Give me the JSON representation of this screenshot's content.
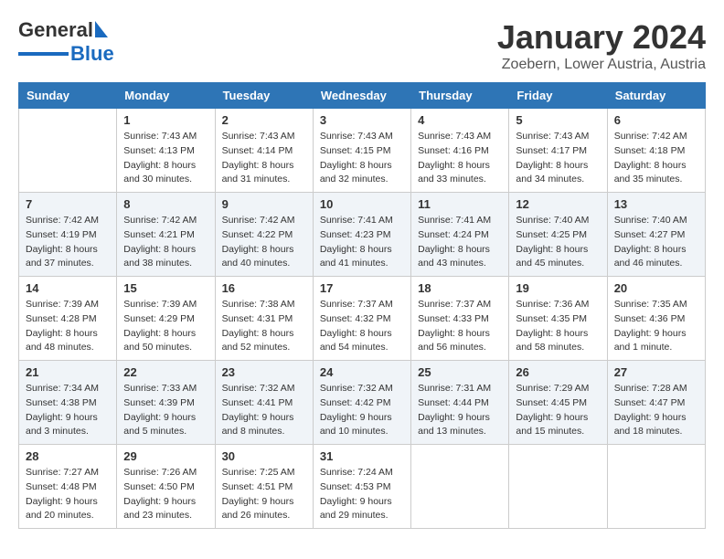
{
  "header": {
    "logo_general": "General",
    "logo_blue": "Blue",
    "month_title": "January 2024",
    "location": "Zoebern, Lower Austria, Austria"
  },
  "columns": [
    "Sunday",
    "Monday",
    "Tuesday",
    "Wednesday",
    "Thursday",
    "Friday",
    "Saturday"
  ],
  "weeks": [
    [
      {
        "day": "",
        "sunrise": "",
        "sunset": "",
        "daylight": ""
      },
      {
        "day": "1",
        "sunrise": "Sunrise: 7:43 AM",
        "sunset": "Sunset: 4:13 PM",
        "daylight": "Daylight: 8 hours and 30 minutes."
      },
      {
        "day": "2",
        "sunrise": "Sunrise: 7:43 AM",
        "sunset": "Sunset: 4:14 PM",
        "daylight": "Daylight: 8 hours and 31 minutes."
      },
      {
        "day": "3",
        "sunrise": "Sunrise: 7:43 AM",
        "sunset": "Sunset: 4:15 PM",
        "daylight": "Daylight: 8 hours and 32 minutes."
      },
      {
        "day": "4",
        "sunrise": "Sunrise: 7:43 AM",
        "sunset": "Sunset: 4:16 PM",
        "daylight": "Daylight: 8 hours and 33 minutes."
      },
      {
        "day": "5",
        "sunrise": "Sunrise: 7:43 AM",
        "sunset": "Sunset: 4:17 PM",
        "daylight": "Daylight: 8 hours and 34 minutes."
      },
      {
        "day": "6",
        "sunrise": "Sunrise: 7:42 AM",
        "sunset": "Sunset: 4:18 PM",
        "daylight": "Daylight: 8 hours and 35 minutes."
      }
    ],
    [
      {
        "day": "7",
        "sunrise": "Sunrise: 7:42 AM",
        "sunset": "Sunset: 4:19 PM",
        "daylight": "Daylight: 8 hours and 37 minutes."
      },
      {
        "day": "8",
        "sunrise": "Sunrise: 7:42 AM",
        "sunset": "Sunset: 4:21 PM",
        "daylight": "Daylight: 8 hours and 38 minutes."
      },
      {
        "day": "9",
        "sunrise": "Sunrise: 7:42 AM",
        "sunset": "Sunset: 4:22 PM",
        "daylight": "Daylight: 8 hours and 40 minutes."
      },
      {
        "day": "10",
        "sunrise": "Sunrise: 7:41 AM",
        "sunset": "Sunset: 4:23 PM",
        "daylight": "Daylight: 8 hours and 41 minutes."
      },
      {
        "day": "11",
        "sunrise": "Sunrise: 7:41 AM",
        "sunset": "Sunset: 4:24 PM",
        "daylight": "Daylight: 8 hours and 43 minutes."
      },
      {
        "day": "12",
        "sunrise": "Sunrise: 7:40 AM",
        "sunset": "Sunset: 4:25 PM",
        "daylight": "Daylight: 8 hours and 45 minutes."
      },
      {
        "day": "13",
        "sunrise": "Sunrise: 7:40 AM",
        "sunset": "Sunset: 4:27 PM",
        "daylight": "Daylight: 8 hours and 46 minutes."
      }
    ],
    [
      {
        "day": "14",
        "sunrise": "Sunrise: 7:39 AM",
        "sunset": "Sunset: 4:28 PM",
        "daylight": "Daylight: 8 hours and 48 minutes."
      },
      {
        "day": "15",
        "sunrise": "Sunrise: 7:39 AM",
        "sunset": "Sunset: 4:29 PM",
        "daylight": "Daylight: 8 hours and 50 minutes."
      },
      {
        "day": "16",
        "sunrise": "Sunrise: 7:38 AM",
        "sunset": "Sunset: 4:31 PM",
        "daylight": "Daylight: 8 hours and 52 minutes."
      },
      {
        "day": "17",
        "sunrise": "Sunrise: 7:37 AM",
        "sunset": "Sunset: 4:32 PM",
        "daylight": "Daylight: 8 hours and 54 minutes."
      },
      {
        "day": "18",
        "sunrise": "Sunrise: 7:37 AM",
        "sunset": "Sunset: 4:33 PM",
        "daylight": "Daylight: 8 hours and 56 minutes."
      },
      {
        "day": "19",
        "sunrise": "Sunrise: 7:36 AM",
        "sunset": "Sunset: 4:35 PM",
        "daylight": "Daylight: 8 hours and 58 minutes."
      },
      {
        "day": "20",
        "sunrise": "Sunrise: 7:35 AM",
        "sunset": "Sunset: 4:36 PM",
        "daylight": "Daylight: 9 hours and 1 minute."
      }
    ],
    [
      {
        "day": "21",
        "sunrise": "Sunrise: 7:34 AM",
        "sunset": "Sunset: 4:38 PM",
        "daylight": "Daylight: 9 hours and 3 minutes."
      },
      {
        "day": "22",
        "sunrise": "Sunrise: 7:33 AM",
        "sunset": "Sunset: 4:39 PM",
        "daylight": "Daylight: 9 hours and 5 minutes."
      },
      {
        "day": "23",
        "sunrise": "Sunrise: 7:32 AM",
        "sunset": "Sunset: 4:41 PM",
        "daylight": "Daylight: 9 hours and 8 minutes."
      },
      {
        "day": "24",
        "sunrise": "Sunrise: 7:32 AM",
        "sunset": "Sunset: 4:42 PM",
        "daylight": "Daylight: 9 hours and 10 minutes."
      },
      {
        "day": "25",
        "sunrise": "Sunrise: 7:31 AM",
        "sunset": "Sunset: 4:44 PM",
        "daylight": "Daylight: 9 hours and 13 minutes."
      },
      {
        "day": "26",
        "sunrise": "Sunrise: 7:29 AM",
        "sunset": "Sunset: 4:45 PM",
        "daylight": "Daylight: 9 hours and 15 minutes."
      },
      {
        "day": "27",
        "sunrise": "Sunrise: 7:28 AM",
        "sunset": "Sunset: 4:47 PM",
        "daylight": "Daylight: 9 hours and 18 minutes."
      }
    ],
    [
      {
        "day": "28",
        "sunrise": "Sunrise: 7:27 AM",
        "sunset": "Sunset: 4:48 PM",
        "daylight": "Daylight: 9 hours and 20 minutes."
      },
      {
        "day": "29",
        "sunrise": "Sunrise: 7:26 AM",
        "sunset": "Sunset: 4:50 PM",
        "daylight": "Daylight: 9 hours and 23 minutes."
      },
      {
        "day": "30",
        "sunrise": "Sunrise: 7:25 AM",
        "sunset": "Sunset: 4:51 PM",
        "daylight": "Daylight: 9 hours and 26 minutes."
      },
      {
        "day": "31",
        "sunrise": "Sunrise: 7:24 AM",
        "sunset": "Sunset: 4:53 PM",
        "daylight": "Daylight: 9 hours and 29 minutes."
      },
      {
        "day": "",
        "sunrise": "",
        "sunset": "",
        "daylight": ""
      },
      {
        "day": "",
        "sunrise": "",
        "sunset": "",
        "daylight": ""
      },
      {
        "day": "",
        "sunrise": "",
        "sunset": "",
        "daylight": ""
      }
    ]
  ]
}
